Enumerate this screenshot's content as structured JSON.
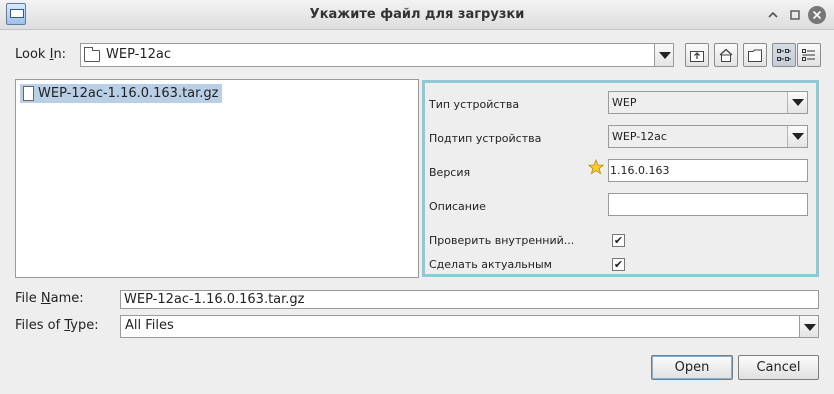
{
  "window": {
    "title": "Укажите файл для загрузки",
    "app_icon": "app-icon",
    "controls": [
      "minimize-icon",
      "maximize-icon",
      "close-icon"
    ]
  },
  "look_in": {
    "label_prefix": "Look ",
    "label_mnemonic": "I",
    "label_suffix": "n:",
    "value": "WEP-12ac"
  },
  "toolbar": {
    "icons": [
      "up-folder-icon",
      "home-icon",
      "new-folder-icon",
      "list-view-icon",
      "details-view-icon"
    ]
  },
  "files": [
    {
      "name": "WEP-12ac-1.16.0.163.tar.gz",
      "selected": true
    }
  ],
  "accessory": {
    "device_type": {
      "label": "Тип устройства",
      "value": "WEP"
    },
    "device_subtype": {
      "label": "Подтип устройства",
      "value": "WEP-12ac"
    },
    "version": {
      "label": "Версия",
      "value": "1.16.0.163"
    },
    "description": {
      "label": "Описание",
      "value": ""
    },
    "verify_internal": {
      "label": "Проверить внутренний...",
      "checked": true
    },
    "make_current": {
      "label": "Сделать актуальным",
      "checked": true
    },
    "check_mark": "✔"
  },
  "file_name": {
    "label_prefix": "File ",
    "label_mnemonic": "N",
    "label_suffix": "ame:",
    "value": "WEP-12ac-1.16.0.163.tar.gz"
  },
  "file_type": {
    "label_prefix": "Files of ",
    "label_mnemonic": "T",
    "label_suffix": "ype:",
    "value": "All Files"
  },
  "buttons": {
    "open": "Open",
    "cancel": "Cancel"
  },
  "colors": {
    "accessory_border": "#8ec9d6",
    "selection": "#b8cfe5"
  }
}
